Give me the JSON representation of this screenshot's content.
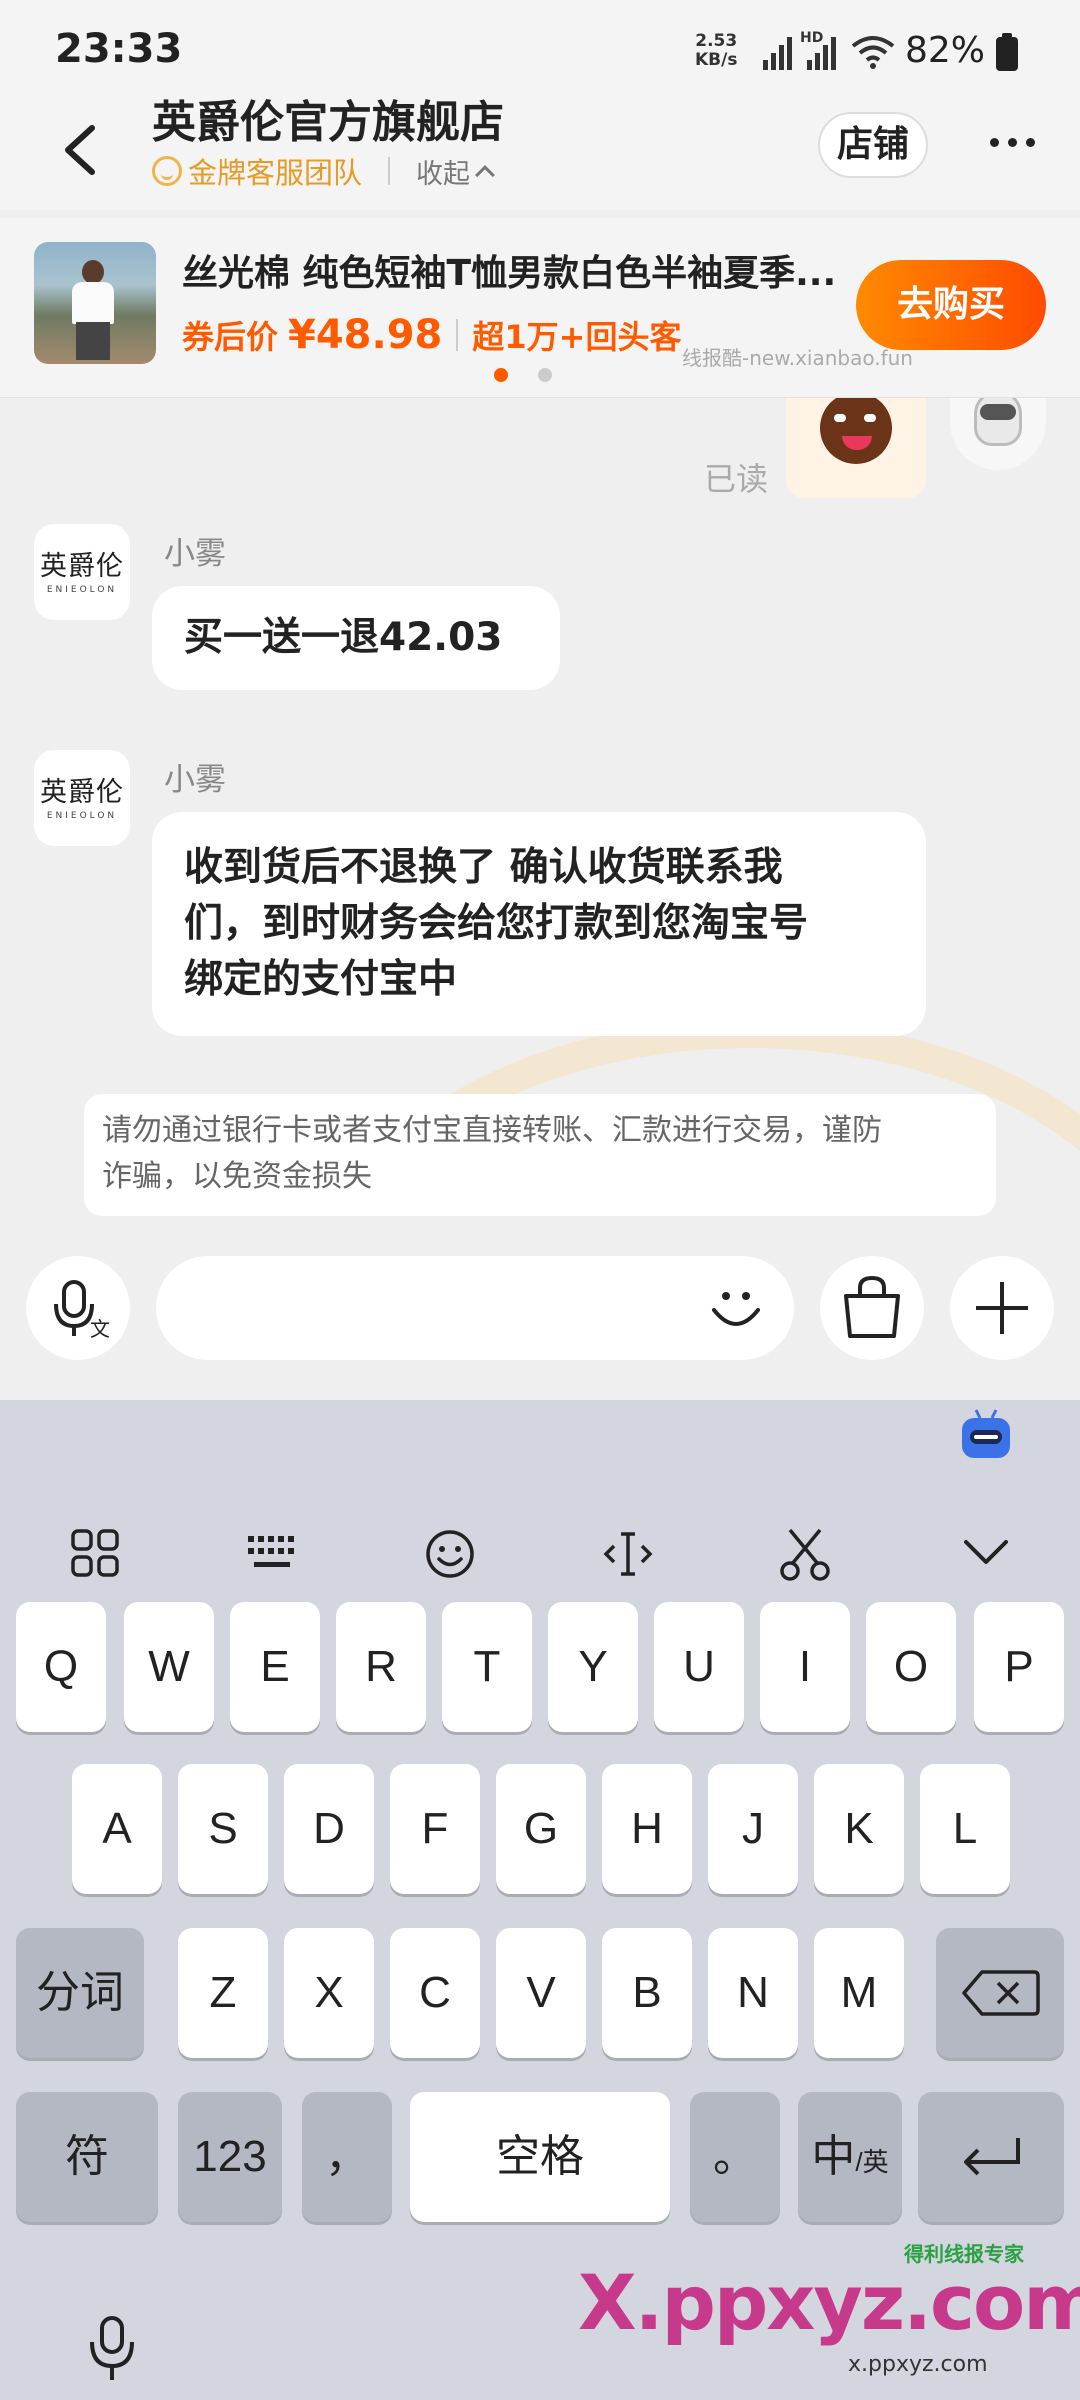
{
  "status_bar": {
    "time": "23:33",
    "net_speed_value": "2.53",
    "net_speed_unit": "KB/s",
    "hd_label": "HD",
    "battery": "82%"
  },
  "header": {
    "shop_name": "英爵伦官方旗舰店",
    "team_label": "金牌客服团队",
    "collapse_label": "收起",
    "store_button": "店铺"
  },
  "product": {
    "title": "丝光棉 纯色短袖T恤男款白色半袖夏季...",
    "price_label": "券后价",
    "price": "¥48.98",
    "repeat_customers": "超1万+回头客",
    "buy_button": "去购买",
    "watermark": "线报酷-new.xianbao.fun"
  },
  "chat": {
    "read_status": "已读",
    "messages": [
      {
        "sender": "小雾",
        "avatar_text": "英爵伦",
        "avatar_subtext": "ENIEOLON",
        "text": "买一送一退42.03"
      },
      {
        "sender": "小雾",
        "avatar_text": "英爵伦",
        "avatar_subtext": "ENIEOLON",
        "lines": [
          "收到货后不退换了 确认收货联系我",
          "们，到时财务会给您打款到您淘宝号",
          "绑定的支付宝中"
        ]
      }
    ],
    "notice_lines": [
      "请勿通过银行卡或者支付宝直接转账、汇款进行交易，谨防",
      "诈骗，以免资金损失"
    ]
  },
  "input_bar": {
    "voice_icon": "voice-translate-icon",
    "emoji_icon": "emoji-icon",
    "bag_icon": "shopping-bag-icon",
    "plus_icon": "plus-icon"
  },
  "keyboard": {
    "row1": [
      "Q",
      "W",
      "E",
      "R",
      "T",
      "Y",
      "U",
      "I",
      "O",
      "P"
    ],
    "row2": [
      "A",
      "S",
      "D",
      "F",
      "G",
      "H",
      "J",
      "K",
      "L"
    ],
    "row3_left": "分词",
    "row3": [
      "Z",
      "X",
      "C",
      "V",
      "B",
      "N",
      "M"
    ],
    "symbol_key": "符",
    "num_key": "123",
    "comma_key": "，",
    "space_key": "空格",
    "period_key": "。",
    "lang_key_main": "中",
    "lang_key_alt": "/英"
  },
  "watermark": {
    "brand": "X.ppxyz.com",
    "url": "x.ppxyz.com",
    "tag": "得利线报专家"
  },
  "colors": {
    "accent_orange": "#ff5a00",
    "gold": "#e59c26",
    "keyboard_bg": "#d3d6de"
  }
}
